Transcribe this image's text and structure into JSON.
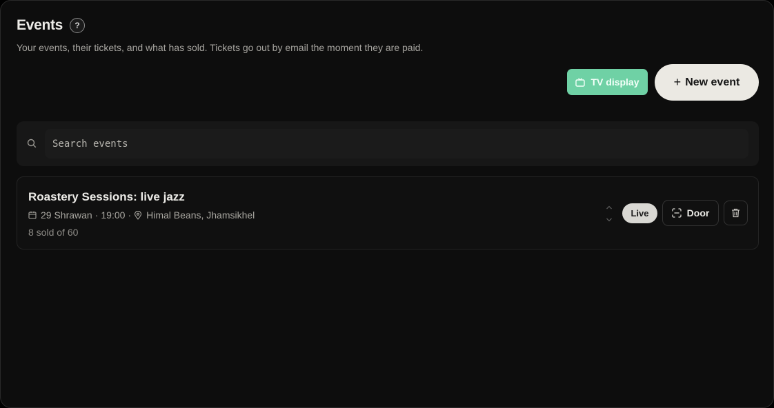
{
  "header": {
    "title": "Events",
    "help_glyph": "?",
    "subtitle": "Your events, their tickets, and what has sold. Tickets go out by email the moment they are paid."
  },
  "toolbar": {
    "tv_display_label": "TV display",
    "tv_display_icon": "tv-icon",
    "new_event_plus": "+",
    "new_event_label": "New event"
  },
  "search": {
    "placeholder": "Search events",
    "value": ""
  },
  "events": [
    {
      "name": "Roastery Sessions: live jazz",
      "date": "29 Shrawan",
      "time": "19:00",
      "venue": "Himal Beans, Jhamsikhel",
      "sold_text": "8 sold of 60",
      "status": "Live",
      "door_label": "Door"
    }
  ],
  "colors": {
    "accent_green": "#6fd1a5",
    "primary_button": "#ebe9e3",
    "background": "#0d0d0d"
  }
}
